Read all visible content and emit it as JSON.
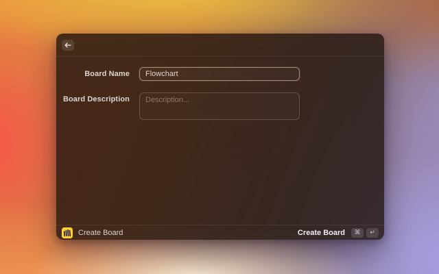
{
  "dialog": {
    "header": {
      "back_icon": "back-arrow"
    },
    "form": {
      "name": {
        "label": "Board Name",
        "value": "Flowchart"
      },
      "description": {
        "label": "Board Description",
        "placeholder": "Description..."
      }
    },
    "footer": {
      "app": {
        "name": "Create Board",
        "icon": "miro-logo"
      },
      "primary_action": {
        "label": "Create Board",
        "shortcut": [
          "⌘",
          "↵"
        ]
      }
    }
  },
  "colors": {
    "brand_yellow": "#ffd02f",
    "brand_logo_dark": "#241a4e",
    "focused_field_border": "#dec4a8"
  }
}
